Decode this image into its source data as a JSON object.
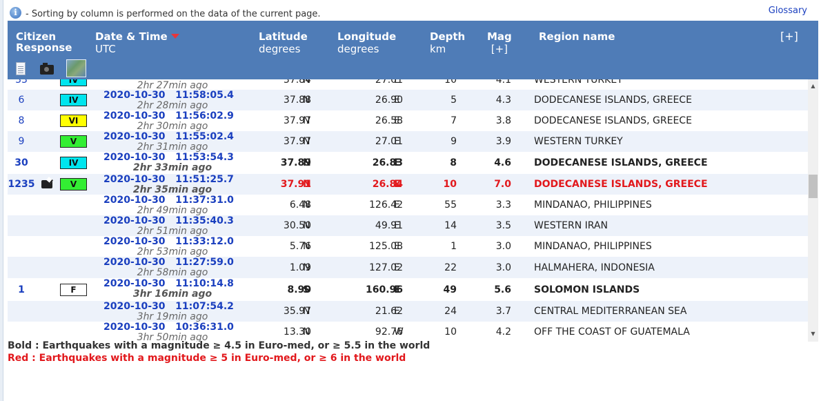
{
  "info": {
    "icon": "info-icon",
    "text": "- Sorting by column is performed on the data of the current page."
  },
  "glossary": "Glossary",
  "header": {
    "citizen": "Citizen",
    "response": "Response",
    "datetime": "Date & Time",
    "utc": "UTC",
    "latitude": "Latitude",
    "lat_unit": "degrees",
    "longitude": "Longitude",
    "lon_unit": "degrees",
    "depth": "Depth",
    "depth_unit": "km",
    "mag": "Mag",
    "mag_expand": "[+]",
    "region": "Region name",
    "expand_all": "[+]"
  },
  "rows": [
    {
      "cr": "33",
      "intensity": "IV",
      "int_color": "#00e5ee",
      "date": "",
      "ago": "2hr 27min ago",
      "lat": "37.84",
      "latd": "N",
      "lon": "27.01",
      "lond": "E",
      "depth": "10",
      "mag": "4.1",
      "region": "WESTERN TURKEY"
    },
    {
      "cr": "6",
      "intensity": "IV",
      "int_color": "#00e5ee",
      "date": "2020-10-30   11:58:05.4",
      "ago": "2hr 28min ago",
      "lat": "37.88",
      "latd": "N",
      "lon": "26.90",
      "lond": "E",
      "depth": "5",
      "mag": "4.3",
      "region": "DODECANESE ISLANDS, GREECE"
    },
    {
      "cr": "8",
      "intensity": "VI",
      "int_color": "#ffff00",
      "date": "2020-10-30   11:56:02.9",
      "ago": "2hr 30min ago",
      "lat": "37.97",
      "latd": "N",
      "lon": "26.58",
      "lond": "E",
      "depth": "7",
      "mag": "3.8",
      "region": "DODECANESE ISLANDS, GREECE"
    },
    {
      "cr": "9",
      "intensity": "V",
      "int_color": "#33ee33",
      "date": "2020-10-30   11:55:02.4",
      "ago": "2hr 31min ago",
      "lat": "37.97",
      "latd": "N",
      "lon": "27.01",
      "lond": "E",
      "depth": "9",
      "mag": "3.9",
      "region": "WESTERN TURKEY"
    },
    {
      "cr": "30",
      "intensity": "IV",
      "int_color": "#00e5ee",
      "date": "2020-10-30   11:53:54.3",
      "ago": "2hr 33min ago",
      "lat": "37.89",
      "latd": "N",
      "lon": "26.83",
      "lond": "E",
      "depth": "8",
      "mag": "4.6",
      "region": "DODECANESE ISLANDS, GREECE"
    },
    {
      "cr": "1235",
      "intensity": "V",
      "int_color": "#33ee33",
      "date": "2020-10-30   11:51:25.7",
      "ago": "2hr 35min ago",
      "lat": "37.91",
      "latd": "N",
      "lon": "26.84",
      "lond": "E",
      "depth": "10",
      "mag": "7.0",
      "region": "DODECANESE ISLANDS, GREECE"
    },
    {
      "cr": "",
      "intensity": "",
      "int_color": "",
      "date": "2020-10-30   11:37:31.0",
      "ago": "2hr 49min ago",
      "lat": "6.48",
      "latd": "N",
      "lon": "126.42",
      "lond": "E",
      "depth": "55",
      "mag": "3.3",
      "region": "MINDANAO, PHILIPPINES"
    },
    {
      "cr": "",
      "intensity": "",
      "int_color": "",
      "date": "2020-10-30   11:35:40.3",
      "ago": "2hr 51min ago",
      "lat": "30.50",
      "latd": "N",
      "lon": "49.91",
      "lond": "E",
      "depth": "14",
      "mag": "3.5",
      "region": "WESTERN IRAN"
    },
    {
      "cr": "",
      "intensity": "",
      "int_color": "",
      "date": "2020-10-30   11:33:12.0",
      "ago": "2hr 53min ago",
      "lat": "5.76",
      "latd": "N",
      "lon": "125.08",
      "lond": "E",
      "depth": "1",
      "mag": "3.0",
      "region": "MINDANAO, PHILIPPINES"
    },
    {
      "cr": "",
      "intensity": "",
      "int_color": "",
      "date": "2020-10-30   11:27:59.0",
      "ago": "2hr 58min ago",
      "lat": "1.09",
      "latd": "N",
      "lon": "127.02",
      "lond": "E",
      "depth": "22",
      "mag": "3.0",
      "region": "HALMAHERA, INDONESIA"
    },
    {
      "cr": "1",
      "intensity": "F",
      "int_color": "#ffffff",
      "date": "2020-10-30   11:10:14.8",
      "ago": "3hr 16min ago",
      "lat": "8.90",
      "latd": "S",
      "lon": "160.96",
      "lond": "E",
      "depth": "49",
      "mag": "5.6",
      "region": "SOLOMON ISLANDS"
    },
    {
      "cr": "",
      "intensity": "",
      "int_color": "",
      "date": "2020-10-30   11:07:54.2",
      "ago": "3hr 19min ago",
      "lat": "35.97",
      "latd": "N",
      "lon": "21.62",
      "lond": "E",
      "depth": "24",
      "mag": "3.7",
      "region": "CENTRAL MEDITERRANEAN SEA"
    },
    {
      "cr": "",
      "intensity": "",
      "int_color": "",
      "date": "2020-10-30   10:36:31.0",
      "ago": "3hr 50min ago",
      "lat": "13.30",
      "latd": "N",
      "lon": "92.76",
      "lond": "W",
      "depth": "10",
      "mag": "4.2",
      "region": "OFF THE COAST OF GUATEMALA"
    }
  ],
  "legend": {
    "bold": "Bold : Earthquakes with a magnitude ≥ 4.5 in Euro-med, or ≥ 5.5 in the world",
    "red": "Red : Earthquakes with a magnitude ≥ 5 in Euro-med, or ≥ 6 in the world"
  },
  "colors": {
    "header_bg": "#4f7cb7",
    "link": "#1a3fbf",
    "red": "#e2181c",
    "alt_row": "#edf2fa"
  }
}
